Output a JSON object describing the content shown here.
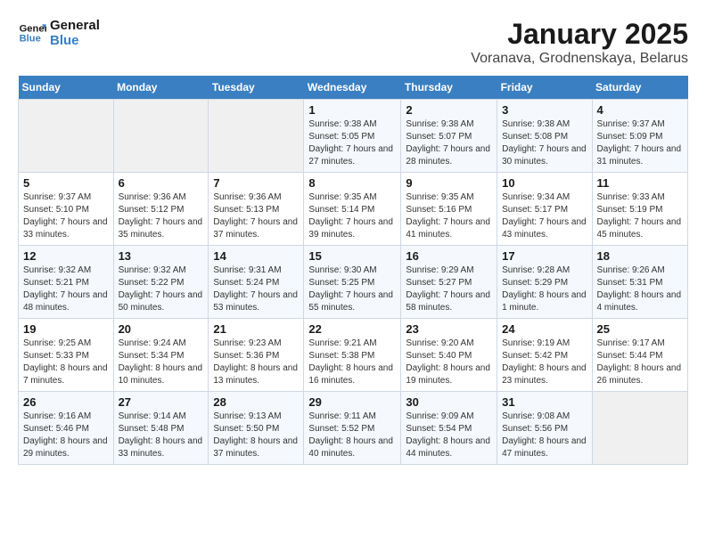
{
  "logo": {
    "line1": "General",
    "line2": "Blue"
  },
  "title": "January 2025",
  "subtitle": "Voranava, Grodnenskaya, Belarus",
  "weekdays": [
    "Sunday",
    "Monday",
    "Tuesday",
    "Wednesday",
    "Thursday",
    "Friday",
    "Saturday"
  ],
  "weeks": [
    [
      {
        "day": "",
        "info": ""
      },
      {
        "day": "",
        "info": ""
      },
      {
        "day": "",
        "info": ""
      },
      {
        "day": "1",
        "info": "Sunrise: 9:38 AM\nSunset: 5:05 PM\nDaylight: 7 hours and 27 minutes."
      },
      {
        "day": "2",
        "info": "Sunrise: 9:38 AM\nSunset: 5:07 PM\nDaylight: 7 hours and 28 minutes."
      },
      {
        "day": "3",
        "info": "Sunrise: 9:38 AM\nSunset: 5:08 PM\nDaylight: 7 hours and 30 minutes."
      },
      {
        "day": "4",
        "info": "Sunrise: 9:37 AM\nSunset: 5:09 PM\nDaylight: 7 hours and 31 minutes."
      }
    ],
    [
      {
        "day": "5",
        "info": "Sunrise: 9:37 AM\nSunset: 5:10 PM\nDaylight: 7 hours and 33 minutes."
      },
      {
        "day": "6",
        "info": "Sunrise: 9:36 AM\nSunset: 5:12 PM\nDaylight: 7 hours and 35 minutes."
      },
      {
        "day": "7",
        "info": "Sunrise: 9:36 AM\nSunset: 5:13 PM\nDaylight: 7 hours and 37 minutes."
      },
      {
        "day": "8",
        "info": "Sunrise: 9:35 AM\nSunset: 5:14 PM\nDaylight: 7 hours and 39 minutes."
      },
      {
        "day": "9",
        "info": "Sunrise: 9:35 AM\nSunset: 5:16 PM\nDaylight: 7 hours and 41 minutes."
      },
      {
        "day": "10",
        "info": "Sunrise: 9:34 AM\nSunset: 5:17 PM\nDaylight: 7 hours and 43 minutes."
      },
      {
        "day": "11",
        "info": "Sunrise: 9:33 AM\nSunset: 5:19 PM\nDaylight: 7 hours and 45 minutes."
      }
    ],
    [
      {
        "day": "12",
        "info": "Sunrise: 9:32 AM\nSunset: 5:21 PM\nDaylight: 7 hours and 48 minutes."
      },
      {
        "day": "13",
        "info": "Sunrise: 9:32 AM\nSunset: 5:22 PM\nDaylight: 7 hours and 50 minutes."
      },
      {
        "day": "14",
        "info": "Sunrise: 9:31 AM\nSunset: 5:24 PM\nDaylight: 7 hours and 53 minutes."
      },
      {
        "day": "15",
        "info": "Sunrise: 9:30 AM\nSunset: 5:25 PM\nDaylight: 7 hours and 55 minutes."
      },
      {
        "day": "16",
        "info": "Sunrise: 9:29 AM\nSunset: 5:27 PM\nDaylight: 7 hours and 58 minutes."
      },
      {
        "day": "17",
        "info": "Sunrise: 9:28 AM\nSunset: 5:29 PM\nDaylight: 8 hours and 1 minute."
      },
      {
        "day": "18",
        "info": "Sunrise: 9:26 AM\nSunset: 5:31 PM\nDaylight: 8 hours and 4 minutes."
      }
    ],
    [
      {
        "day": "19",
        "info": "Sunrise: 9:25 AM\nSunset: 5:33 PM\nDaylight: 8 hours and 7 minutes."
      },
      {
        "day": "20",
        "info": "Sunrise: 9:24 AM\nSunset: 5:34 PM\nDaylight: 8 hours and 10 minutes."
      },
      {
        "day": "21",
        "info": "Sunrise: 9:23 AM\nSunset: 5:36 PM\nDaylight: 8 hours and 13 minutes."
      },
      {
        "day": "22",
        "info": "Sunrise: 9:21 AM\nSunset: 5:38 PM\nDaylight: 8 hours and 16 minutes."
      },
      {
        "day": "23",
        "info": "Sunrise: 9:20 AM\nSunset: 5:40 PM\nDaylight: 8 hours and 19 minutes."
      },
      {
        "day": "24",
        "info": "Sunrise: 9:19 AM\nSunset: 5:42 PM\nDaylight: 8 hours and 23 minutes."
      },
      {
        "day": "25",
        "info": "Sunrise: 9:17 AM\nSunset: 5:44 PM\nDaylight: 8 hours and 26 minutes."
      }
    ],
    [
      {
        "day": "26",
        "info": "Sunrise: 9:16 AM\nSunset: 5:46 PM\nDaylight: 8 hours and 29 minutes."
      },
      {
        "day": "27",
        "info": "Sunrise: 9:14 AM\nSunset: 5:48 PM\nDaylight: 8 hours and 33 minutes."
      },
      {
        "day": "28",
        "info": "Sunrise: 9:13 AM\nSunset: 5:50 PM\nDaylight: 8 hours and 37 minutes."
      },
      {
        "day": "29",
        "info": "Sunrise: 9:11 AM\nSunset: 5:52 PM\nDaylight: 8 hours and 40 minutes."
      },
      {
        "day": "30",
        "info": "Sunrise: 9:09 AM\nSunset: 5:54 PM\nDaylight: 8 hours and 44 minutes."
      },
      {
        "day": "31",
        "info": "Sunrise: 9:08 AM\nSunset: 5:56 PM\nDaylight: 8 hours and 47 minutes."
      },
      {
        "day": "",
        "info": ""
      }
    ]
  ]
}
